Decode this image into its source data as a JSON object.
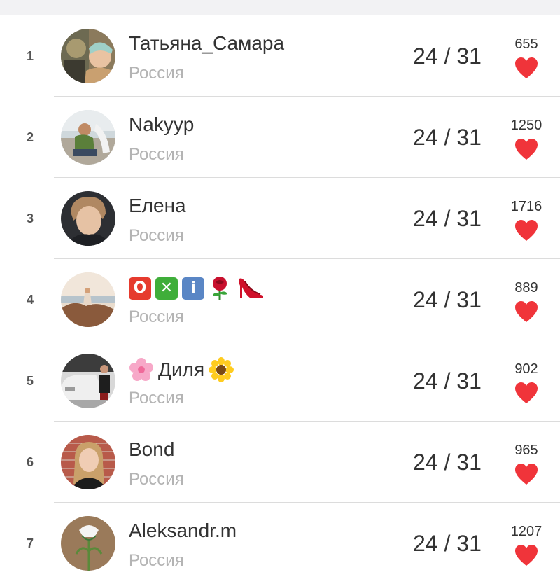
{
  "rows": [
    {
      "rank": "1",
      "name": "Татьяна_Самара",
      "country": "Россия",
      "score": "24 / 31",
      "likes": "655"
    },
    {
      "rank": "2",
      "name": "Nakyyp",
      "country": "Россия",
      "score": "24 / 31",
      "likes": "1250"
    },
    {
      "rank": "3",
      "name": "Елена",
      "country": "Россия",
      "score": "24 / 31",
      "likes": "1716"
    },
    {
      "rank": "4",
      "name_parts": [
        "O",
        "✕",
        "i"
      ],
      "country": "Россия",
      "score": "24 / 31",
      "likes": "889"
    },
    {
      "rank": "5",
      "name": "Диля",
      "country": "Россия",
      "score": "24 / 31",
      "likes": "902"
    },
    {
      "rank": "6",
      "name": "Bond",
      "country": "Россия",
      "score": "24 / 31",
      "likes": "965"
    },
    {
      "rank": "7",
      "name": "Aleksandr.m",
      "country": "Россия",
      "score": "24 / 31",
      "likes": "1207"
    }
  ],
  "colors": {
    "heart": "#f0343a",
    "ok_red": "#e63b2e",
    "ok_green": "#3fae3a",
    "ok_blue": "#5a86c5"
  },
  "icons": {
    "like": "heart-icon",
    "emoji_rose": "rose-icon",
    "emoji_heel": "high-heel-icon",
    "emoji_blossom": "cherry-blossom-icon",
    "emoji_sunflower": "sunflower-icon"
  }
}
